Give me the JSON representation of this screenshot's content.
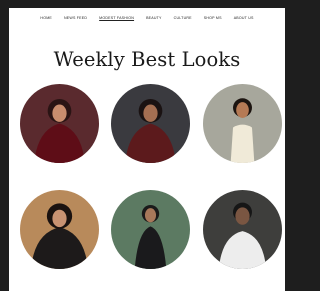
{
  "nav": {
    "items": [
      "HOME",
      "NEWS FEED",
      "MODEST FASHION",
      "BEAUTY",
      "CULTURE",
      "SHOP MS",
      "ABOUT US"
    ],
    "active_index": 2
  },
  "page": {
    "title": "Weekly Best Looks"
  },
  "looks": [
    {
      "name": "look-1",
      "background": "#5a2a2e",
      "outfit": "#5e0d17",
      "skin": "#c98d6e",
      "hair": "#2a1414"
    },
    {
      "name": "look-2",
      "background": "#3a3a3f",
      "outfit": "#5c1a1c",
      "skin": "#a56f52",
      "hair": "#1a1212"
    },
    {
      "name": "look-3",
      "background": "#a7a79c",
      "outfit": "#f0ead8",
      "skin": "#b57a55",
      "hair": "#1c1410"
    },
    {
      "name": "look-4",
      "background": "#b88a5b",
      "outfit": "#1d1a1a",
      "skin": "#c89272",
      "hair": "#1a1210"
    },
    {
      "name": "look-5",
      "background": "#5c7a62",
      "outfit": "#1a1a1c",
      "skin": "#a7785a",
      "hair": "#1a1a1a"
    },
    {
      "name": "look-6",
      "background": "#3e3e3c",
      "outfit": "#ededed",
      "skin": "#7a5642",
      "hair": "#161616"
    }
  ]
}
